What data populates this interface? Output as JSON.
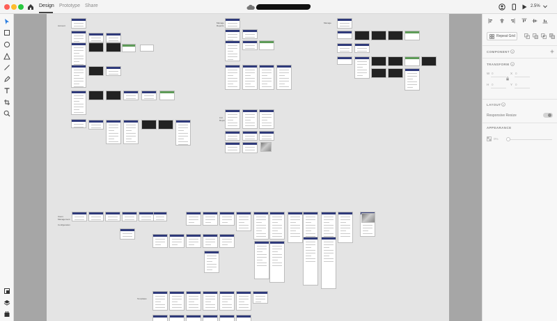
{
  "header": {
    "tabs": [
      {
        "label": "Design",
        "active": true
      },
      {
        "label": "Prototype",
        "active": false
      },
      {
        "label": "Share",
        "active": false
      }
    ],
    "zoom": "2.5%",
    "icons": [
      "home-icon",
      "cloud-icon",
      "user-icon",
      "mobile-preview-icon",
      "desktop-preview-icon",
      "play-icon",
      "chevron-down-icon"
    ]
  },
  "tools": [
    "select-icon",
    "rectangle-icon",
    "ellipse-icon",
    "triangle-icon",
    "line-icon",
    "pen-icon",
    "text-icon",
    "artboard-icon",
    "zoom-icon",
    "assets-icon",
    "layers-icon",
    "plugins-icon"
  ],
  "canvas": {
    "labels": [
      "Account",
      "Manage Reports",
      "Manage",
      "List Reports",
      "Users Management",
      "Configuration",
      "Templates"
    ]
  },
  "panel": {
    "repeat_grid": "Repeat Grid",
    "component": "COMPONENT",
    "transform": "TRANSFORM",
    "fields": {
      "w": "W",
      "w_val": "0",
      "x": "X",
      "x_val": "0",
      "h": "H",
      "h_val": "0",
      "y": "Y",
      "y_val": "0"
    },
    "layout": "LAYOUT",
    "responsive_resize": "Responsive Resize",
    "responsive_enabled": true,
    "appearance": "APPEARANCE",
    "opacity": "0%"
  },
  "colors": {
    "accent": "#2f3a7a",
    "canvas": "#a6a6a6",
    "artboard": "#e4e4e4"
  }
}
